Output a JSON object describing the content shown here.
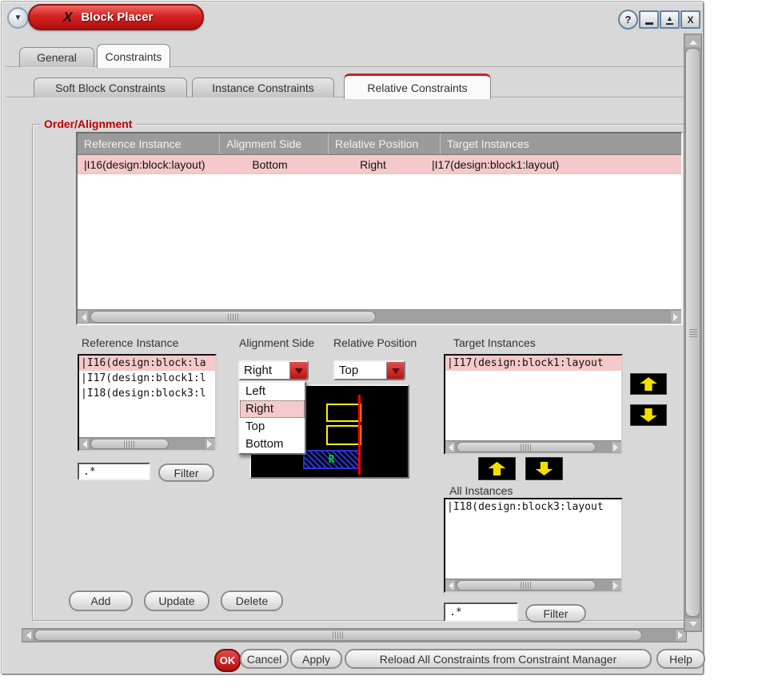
{
  "window": {
    "title": "Block Placer",
    "icon_glyph": "X",
    "menu_glyph": "▼",
    "help_glyph": "?",
    "maximize_glyph": "▲",
    "close_glyph": "X"
  },
  "tabs": {
    "general": "General",
    "constraints": "Constraints"
  },
  "subtabs": {
    "soft": "Soft Block Constraints",
    "instance": "Instance Constraints",
    "relative": "Relative Constraints"
  },
  "group_title": "Order/Alignment",
  "table": {
    "columns": [
      "Reference Instance",
      "Alignment Side",
      "Relative Position",
      "Target Instances"
    ],
    "row": {
      "reference": "|I16(design:block:layout)",
      "side": "Bottom",
      "position": "Right",
      "targets": "|I17(design:block1:layout)"
    }
  },
  "reference": {
    "label": "Reference Instance",
    "items": [
      "|I16(design:block:la",
      "|I17(design:block1:l",
      "|I18(design:block3:l"
    ],
    "filter_value": ".*",
    "filter_label": "Filter"
  },
  "alignment": {
    "label": "Alignment Side",
    "value": "Right",
    "menu": [
      "Left",
      "Right",
      "Top",
      "Bottom"
    ]
  },
  "relative": {
    "label": "Relative Position",
    "value": "Top"
  },
  "target": {
    "label": "Target Instances",
    "items": [
      "|I17(design:block1:layout"
    ]
  },
  "all_instances": {
    "label": "All Instances",
    "items": [
      "|I18(design:block3:layout"
    ],
    "filter_value": ".*",
    "filter_label": "Filter"
  },
  "preview": {
    "r_label": "R"
  },
  "buttons": {
    "add": "Add",
    "update": "Update",
    "delete": "Delete"
  },
  "footer": {
    "ok": "OK",
    "cancel": "Cancel",
    "apply": "Apply",
    "reload": "Reload All Constraints from Constraint Manager",
    "help": "Help"
  },
  "colors": {
    "accent_red": "#cc1a1a",
    "selection_pink": "#f5c9c9",
    "canvas_yellow": "#ffee00",
    "canvas_red": "#ff0000",
    "canvas_blue": "#2b35d8",
    "canvas_green": "#00d02a"
  }
}
